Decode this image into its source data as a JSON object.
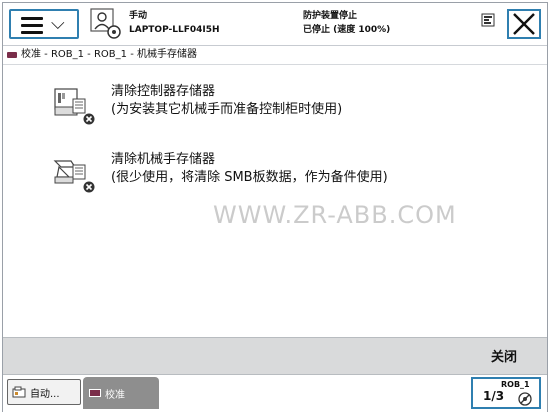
{
  "header": {
    "mode_label": "手动",
    "controller_name": "LAPTOP-LLF04I5H",
    "status_line1": "防护装置停止",
    "status_line2": "已停止 (速度 100%)"
  },
  "breadcrumb": {
    "text": "校准 - ROB_1 - ROB_1 - 机械手存储器"
  },
  "options": [
    {
      "title": "清除控制器存储器",
      "subtitle": "(为安装其它机械手而准备控制柜时使用)"
    },
    {
      "title": "清除机械手存储器",
      "subtitle": "(很少使用，将清除 SMB板数据，作为备件使用)"
    }
  ],
  "watermark": "WWW.ZR-ABB.COM",
  "footer": {
    "close_label": "关闭"
  },
  "taskbar": {
    "auto_label": "自动...",
    "calibration_label": "校准",
    "robot_name": "ROB_1",
    "robot_fraction": "1/3"
  },
  "colors": {
    "accent_border": "#2f7fb0",
    "bottom_bar": "#d9dadb",
    "task_tab_active": "#8e8e8e",
    "icon_error_red": "#cc2b2b"
  },
  "icons": {
    "menu": "hamburger-chevron-icon",
    "user": "user-gear-icon",
    "quickset": "quickset-icon",
    "close": "close-icon",
    "controller_memory": "controller-memory-clear-icon",
    "robot_memory": "robot-memory-clear-icon"
  }
}
